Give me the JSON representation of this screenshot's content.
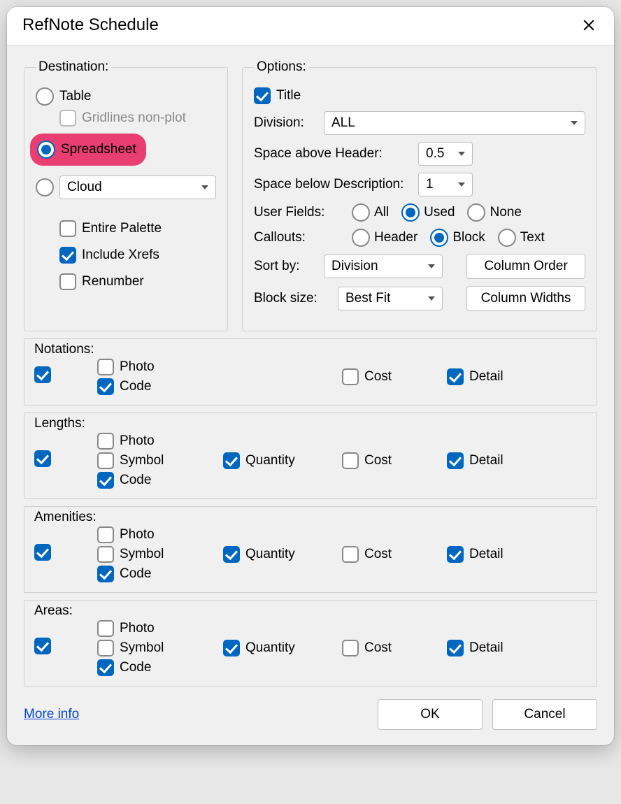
{
  "window": {
    "title": "RefNote Schedule"
  },
  "destination": {
    "legend": "Destination:",
    "table": "Table",
    "gridlines": "Gridlines non-plot",
    "spreadsheet": "Spreadsheet",
    "cloud": "Cloud",
    "entire_palette": "Entire Palette",
    "include_xrefs": "Include Xrefs",
    "renumber": "Renumber"
  },
  "options": {
    "legend": "Options:",
    "title_label": "Title",
    "division_label": "Division:",
    "division_value": "ALL",
    "space_above_label": "Space above Header:",
    "space_above_value": "0.5",
    "space_below_label": "Space below Description:",
    "space_below_value": "1",
    "user_fields_label": "User Fields:",
    "uf_all": "All",
    "uf_used": "Used",
    "uf_none": "None",
    "callouts_label": "Callouts:",
    "co_header": "Header",
    "co_block": "Block",
    "co_text": "Text",
    "sortby_label": "Sort by:",
    "sortby_value": "Division",
    "column_order": "Column Order",
    "blocksize_label": "Block size:",
    "blocksize_value": "Best Fit",
    "column_widths": "Column Widths"
  },
  "labels": {
    "photo": "Photo",
    "symbol": "Symbol",
    "code": "Code",
    "quantity": "Quantity",
    "cost": "Cost",
    "detail": "Detail"
  },
  "categories": {
    "notations": "Notations:",
    "lengths": "Lengths:",
    "amenities": "Amenities:",
    "areas": "Areas:"
  },
  "footer": {
    "more_info": "More info",
    "ok": "OK",
    "cancel": "Cancel"
  }
}
